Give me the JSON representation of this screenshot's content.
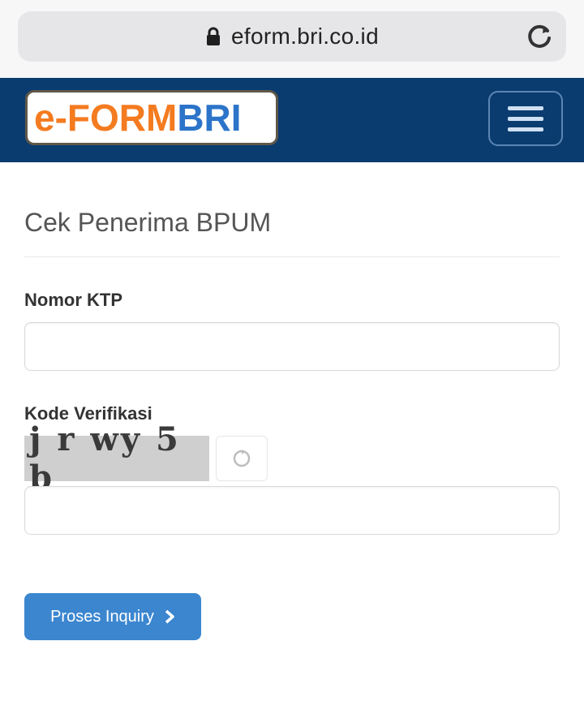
{
  "browser": {
    "url": "eform.bri.co.id"
  },
  "header": {
    "logo_prefix": "e-FORM",
    "logo_suffix": "BRI"
  },
  "form": {
    "title": "Cek Penerima BPUM",
    "ktp_label": "Nomor KTP",
    "ktp_value": "",
    "verification_label": "Kode Verifikasi",
    "captcha_text": "j r wy 5 b",
    "verification_value": "",
    "submit_label": "Proses Inquiry"
  },
  "colors": {
    "header_bg": "#0b3c6f",
    "logo_orange": "#f47b20",
    "logo_blue": "#2c74c9",
    "button_bg": "#3b86cf"
  },
  "icons": {
    "lock": "lock-icon",
    "reload": "reload-icon",
    "menu": "hamburger-icon",
    "captcha_refresh": "refresh-icon",
    "submit_arrow": "chevron-right-icon"
  }
}
